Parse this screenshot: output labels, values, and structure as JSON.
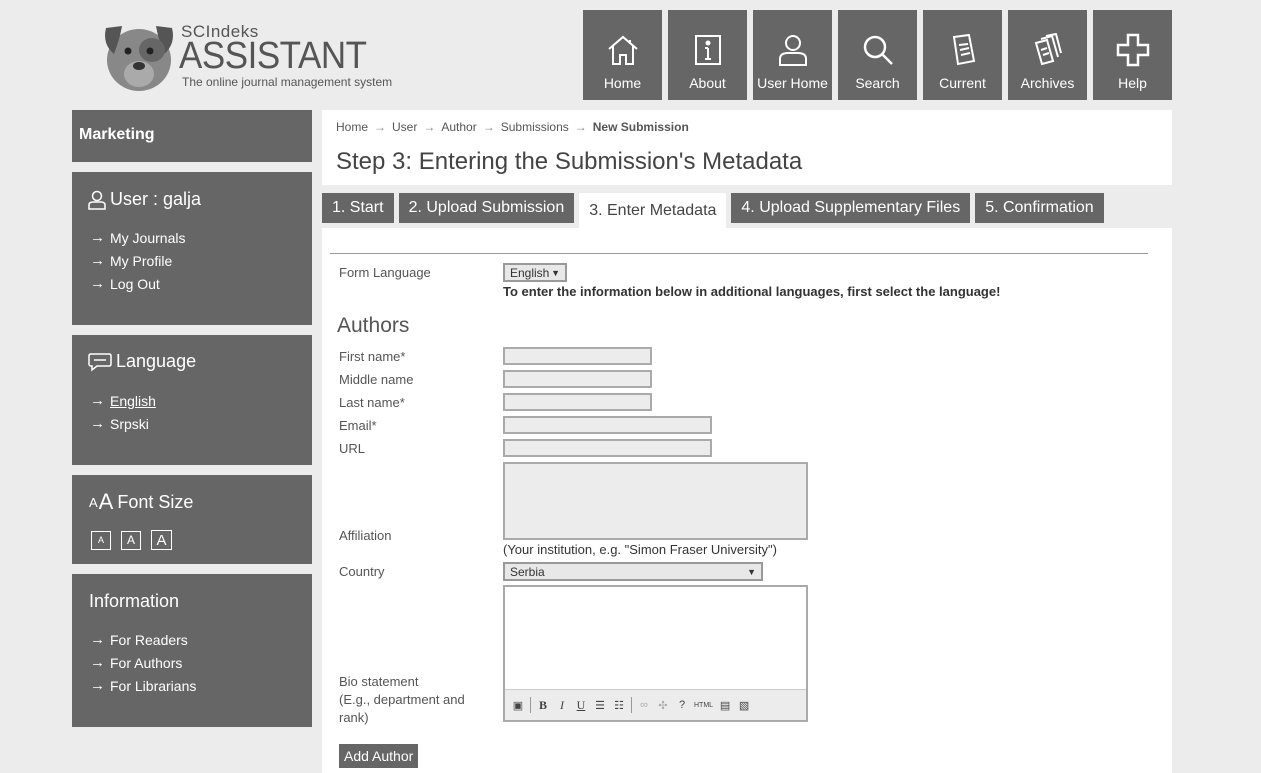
{
  "brand": {
    "small": "SCIndeks",
    "large": "ASSISTANT",
    "tagline": "The online journal management system"
  },
  "topnav": [
    {
      "label": "Home",
      "icon": "home-icon"
    },
    {
      "label": "About",
      "icon": "info-icon"
    },
    {
      "label": "User Home",
      "icon": "user-icon"
    },
    {
      "label": "Search",
      "icon": "search-icon"
    },
    {
      "label": "Current",
      "icon": "document-icon"
    },
    {
      "label": "Archives",
      "icon": "archives-icon"
    },
    {
      "label": "Help",
      "icon": "plus-icon"
    }
  ],
  "sidebar": {
    "marketing": "Marketing",
    "user": {
      "title": "User : galja",
      "items": [
        "My Journals",
        "My Profile",
        "Log Out"
      ]
    },
    "language": {
      "title": "Language",
      "items": [
        "English",
        "Srpski"
      ]
    },
    "fontsize": {
      "title": "Font Size",
      "buttons": [
        "A",
        "A",
        "A"
      ]
    },
    "information": {
      "title": "Information",
      "items": [
        "For Readers",
        "For Authors",
        "For Librarians"
      ]
    }
  },
  "breadcrumb": [
    "Home",
    "User",
    "Author",
    "Submissions",
    "New Submission"
  ],
  "page_title": "Step 3: Entering the Submission's Metadata",
  "tabs": [
    "1. Start",
    "2. Upload Submission",
    "3. Enter Metadata",
    "4. Upload Supplementary Files",
    "5. Confirmation"
  ],
  "form": {
    "form_language_label": "Form Language",
    "form_language_value": "English",
    "form_language_note": "To enter the information below in additional languages, first select the language!",
    "authors_heading": "Authors",
    "first_name_label": "First name*",
    "middle_name_label": "Middle name",
    "last_name_label": "Last name*",
    "email_label": "Email*",
    "url_label": "URL",
    "affiliation_label": "Affiliation",
    "affiliation_hint": "(Your institution, e.g. \"Simon Fraser University\")",
    "country_label": "Country",
    "country_value": "Serbia",
    "bio_label_1": "Bio statement",
    "bio_label_2": "(E.g., department and",
    "bio_label_3": "rank)",
    "toolbar_html": "HTML",
    "add_author": "Add Author"
  }
}
